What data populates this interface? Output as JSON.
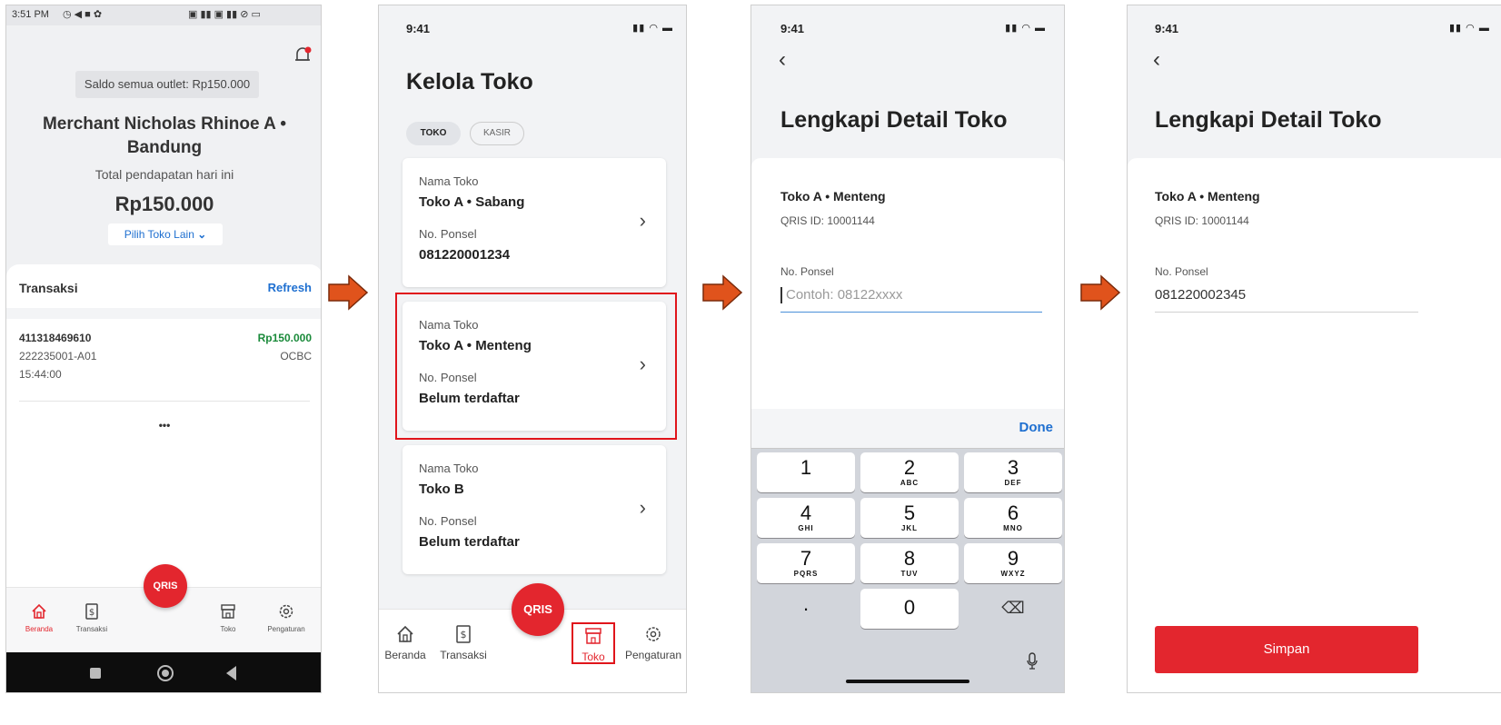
{
  "screen1": {
    "status_time": "3:51 PM",
    "balance_chip": "Saldo semua outlet: Rp150.000",
    "merchant_name_line1": "Merchant Nicholas Rhinoe A •",
    "merchant_name_line2": "Bandung",
    "income_label": "Total pendapatan hari ini",
    "income_value": "Rp150.000",
    "switch_store": "Pilih Toko Lain",
    "tx_title": "Transaksi",
    "refresh": "Refresh",
    "tx_id": "411318469610",
    "tx_amount": "Rp150.000",
    "tx_terminal": "222235001-A01",
    "tx_bank": "OCBC",
    "tx_time": "15:44:00",
    "more": "•••",
    "fab": "QRIS",
    "nav": [
      "Beranda",
      "Transaksi",
      "Toko",
      "Pengaturan"
    ]
  },
  "screen2": {
    "status_time": "9:41",
    "title": "Kelola Toko",
    "tabs": [
      "TOKO",
      "KASIR"
    ],
    "stores": [
      {
        "name_label": "Nama Toko",
        "name": "Toko A • Sabang",
        "phone_label": "No. Ponsel",
        "phone": "081220001234"
      },
      {
        "name_label": "Nama Toko",
        "name": "Toko A • Menteng",
        "phone_label": "No. Ponsel",
        "phone": "Belum terdaftar"
      },
      {
        "name_label": "Nama Toko",
        "name": "Toko B",
        "phone_label": "No. Ponsel",
        "phone": "Belum terdaftar"
      }
    ],
    "fab": "QRIS",
    "nav": [
      "Beranda",
      "Transaksi",
      "Toko",
      "Pengaturan"
    ]
  },
  "screen3": {
    "status_time": "9:41",
    "back": "‹",
    "title": "Lengkapi Detail Toko",
    "store_name": "Toko A • Menteng",
    "qris_id": "QRIS ID: 10001144",
    "phone_label": "No. Ponsel",
    "phone_placeholder": "Contoh: 08122xxxx",
    "done": "Done",
    "keys": [
      {
        "n": "1",
        "l": ""
      },
      {
        "n": "2",
        "l": "ABC"
      },
      {
        "n": "3",
        "l": "DEF"
      },
      {
        "n": "4",
        "l": "GHI"
      },
      {
        "n": "5",
        "l": "JKL"
      },
      {
        "n": "6",
        "l": "MNO"
      },
      {
        "n": "7",
        "l": "PQRS"
      },
      {
        "n": "8",
        "l": "TUV"
      },
      {
        "n": "9",
        "l": "WXYZ"
      },
      {
        "n": ".",
        "l": ""
      },
      {
        "n": "0",
        "l": ""
      },
      {
        "n": "⌫",
        "l": ""
      }
    ]
  },
  "screen4": {
    "status_time": "9:41",
    "back": "‹",
    "title": "Lengkapi Detail Toko",
    "store_name": "Toko A • Menteng",
    "qris_id": "QRIS ID: 10001144",
    "phone_label": "No. Ponsel",
    "phone_value": "081220002345",
    "save": "Simpan"
  },
  "colors": {
    "brand_red": "#e3262e",
    "link_blue": "#1e6fd0",
    "money_green": "#1a8a3a",
    "arrow_orange": "#e0531c",
    "highlight_red": "#e0151b"
  }
}
